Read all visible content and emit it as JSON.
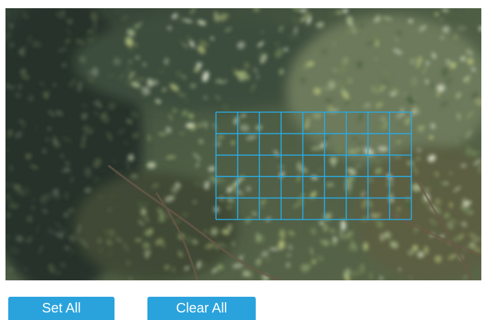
{
  "video": {
    "description_icon": "camera-feed"
  },
  "detection_grid": {
    "columns": 9,
    "rows": 5,
    "line_color": "#2aa9e0"
  },
  "actions": {
    "set_all_label": "Set All",
    "clear_all_label": "Clear All",
    "button_color": "#2aa3dd"
  }
}
